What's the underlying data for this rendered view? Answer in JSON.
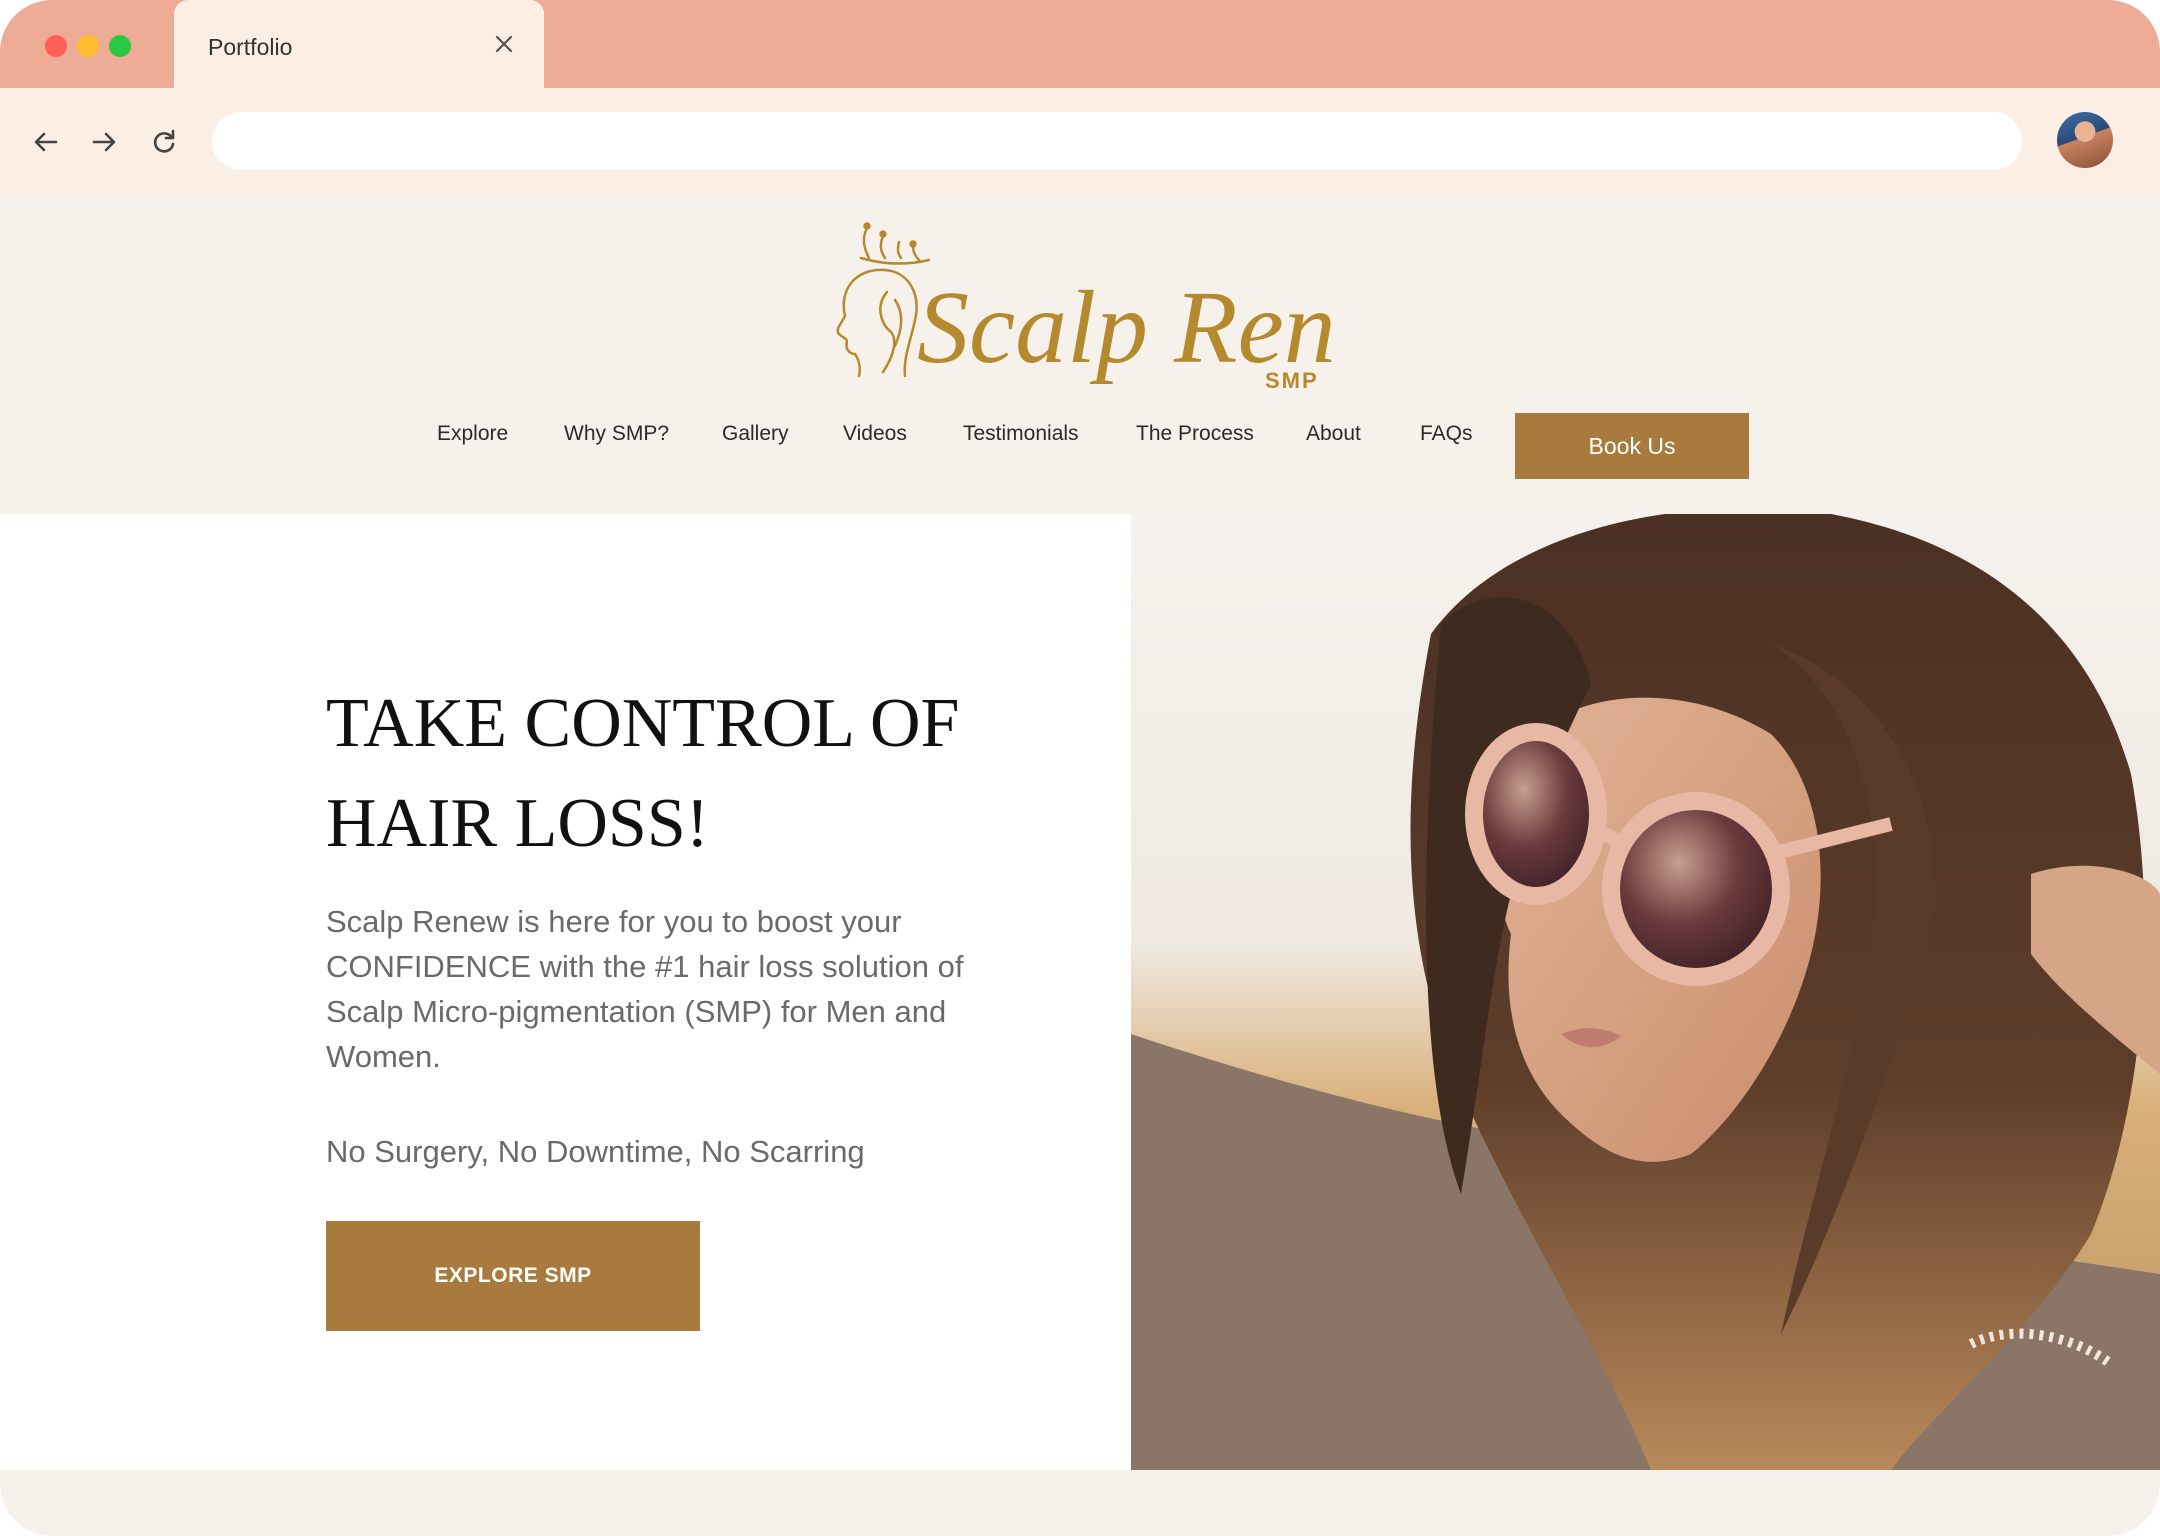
{
  "browser": {
    "tab_title": "Portfolio",
    "address_value": "",
    "address_placeholder": ""
  },
  "site": {
    "logo_text": "Scalp Renew",
    "logo_sub": "SMP",
    "nav": [
      "Explore",
      "Why SMP?",
      "Gallery",
      "Videos",
      "Testimonials",
      "The Process",
      "About",
      "FAQs"
    ],
    "book_label": "Book Us",
    "brand_color": "#a87a3e",
    "gold_color": "#b58a2e"
  },
  "hero": {
    "title_line1": "TAKE CONTROL OF",
    "title_line2": "HAIR LOSS!",
    "body": "Scalp Renew is here for you to boost your CONFIDENCE with the #1 hair loss solution of Scalp Micro-pigmentation (SMP) for Men and Women.",
    "sub": "No Surgery, No Downtime, No Scarring",
    "cta_label": "EXPLORE SMP",
    "image_alt": "woman-with-sunglasses-photo"
  }
}
